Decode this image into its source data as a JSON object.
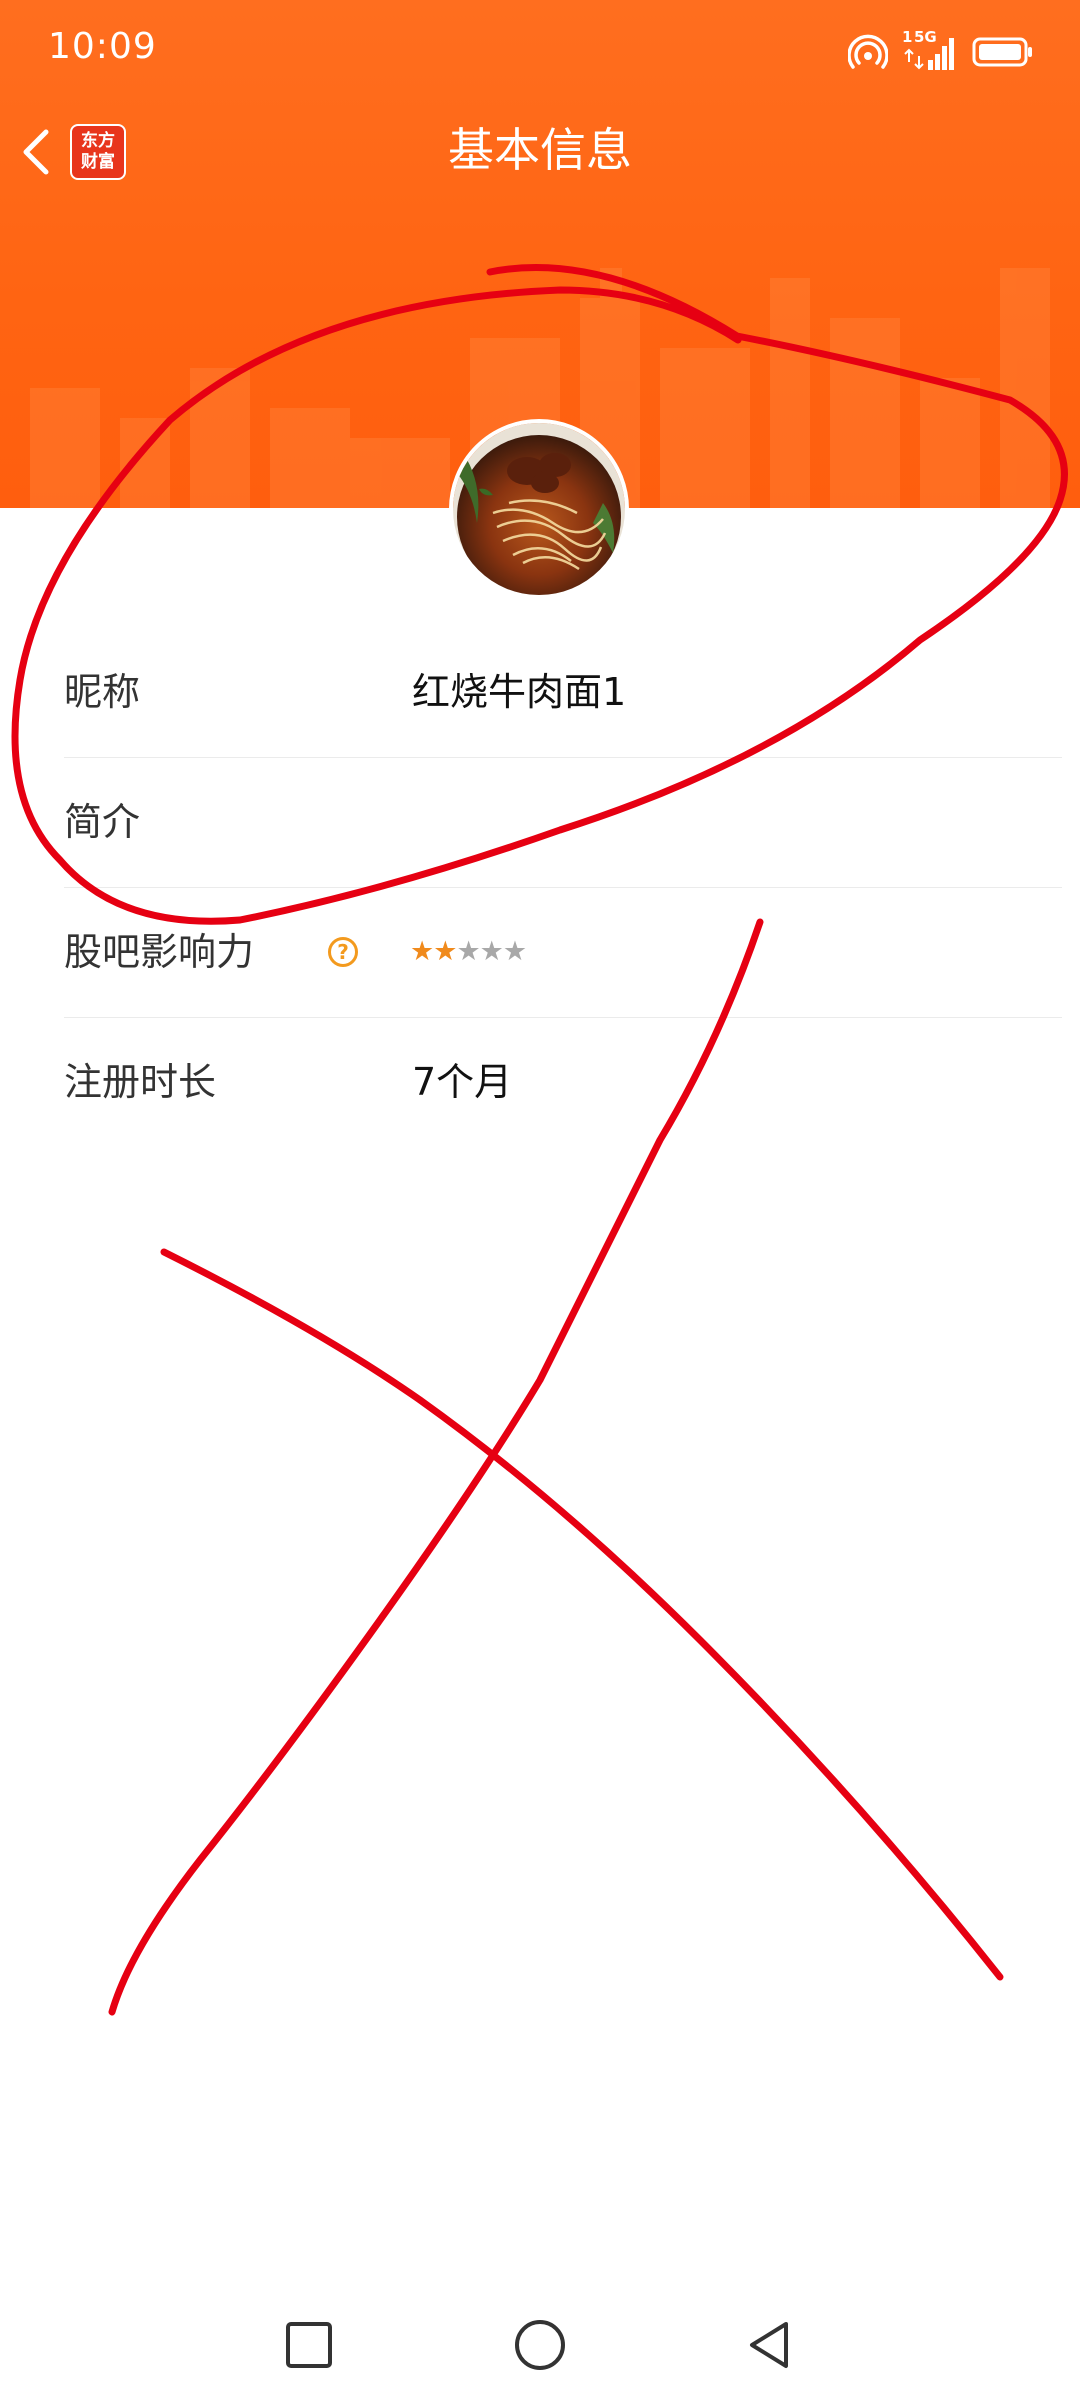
{
  "status_bar": {
    "time": "10:09",
    "network": "5G",
    "sim_slot": "1",
    "icons": [
      "hotspot-icon",
      "signal-icon",
      "battery-icon"
    ]
  },
  "navbar": {
    "title": "基本信息",
    "back_icon": "chevron-left-icon",
    "app_logo_line1": "东方",
    "app_logo_line2": "财富"
  },
  "profile": {
    "avatar": "beef-noodle-photo"
  },
  "info": {
    "nickname_label": "昵称",
    "nickname_value": "红烧牛肉面1",
    "bio_label": "简介",
    "bio_value": "",
    "influence_label": "股吧影响力",
    "influence_help_icon": "question-circle-icon",
    "influence_help_symbol": "?",
    "influence_rating": 2,
    "influence_max": 5,
    "register_label": "注册时长",
    "register_value": "7个月"
  },
  "system_nav": {
    "icons": [
      "square-recents-icon",
      "circle-home-icon",
      "triangle-back-icon"
    ]
  },
  "colors": {
    "header_orange": "#ff6412",
    "star_active": "#f08a1c",
    "star_inactive": "#a8a8a8",
    "annotation_red": "#e60012"
  }
}
